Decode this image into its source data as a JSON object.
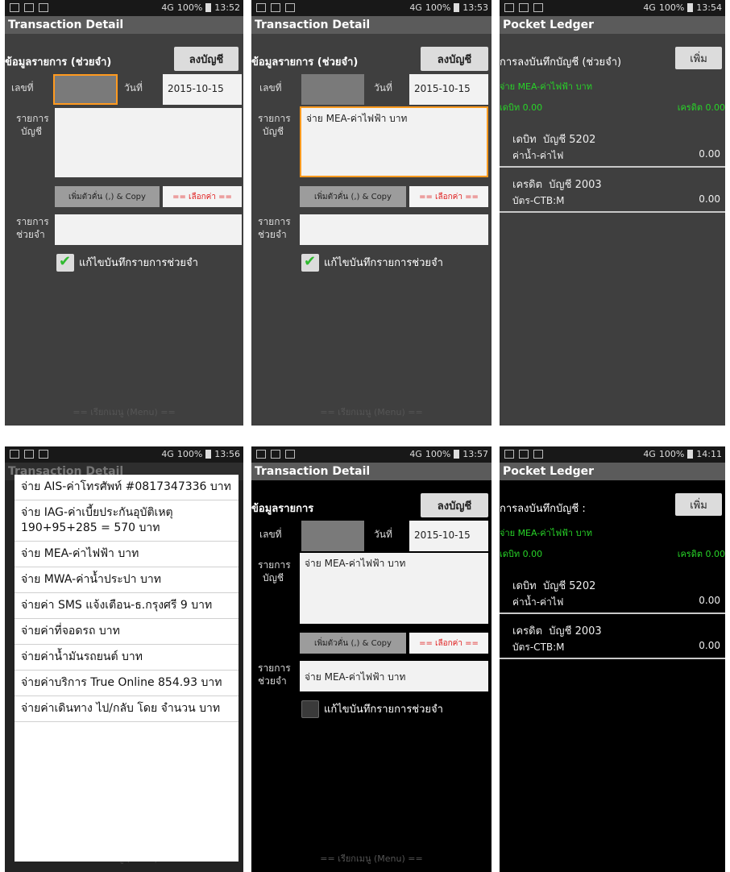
{
  "statusbar": {
    "network": "4G",
    "battery": "100%",
    "times": [
      "13:52",
      "13:53",
      "13:54",
      "13:56",
      "13:57",
      "14:11"
    ]
  },
  "titles": {
    "transaction_detail": "Transaction Detail",
    "pocket_ledger": "Pocket Ledger"
  },
  "form": {
    "heading_helper": "ข้อมูลรายการ (ช่วยจำ)",
    "heading_plain": "ข้อมูลรายการ",
    "post_button": "ลงบัญชี",
    "number_label": "เลขที่",
    "date_label": "วันที่",
    "date_value": "2015-10-15",
    "account_line1": "รายการ",
    "account_line2": "บัญชี",
    "account_value": "จ่าย MEA-ค่าไฟฟ้า  บาท",
    "add_sep_copy": "เพิ่มตัวคั่น (,) & Copy",
    "select_value": "== เลือกค่า ==",
    "helper_line1": "รายการ",
    "helper_line2": "ช่วยจำ",
    "helper_value": "จ่าย MEA-ค่าไฟฟ้า  บาท",
    "edit_helper_label": "แก้ไขบันทึกรายการช่วยจำ",
    "menu_hint": "== เรียกเมนู (Menu) =="
  },
  "ledger": {
    "heading_helper": "การลงบันทึกบัญชี (ช่วยจำ)",
    "heading_plain": "การลงบันทึกบัญชี :",
    "add_button": "เพิ่ม",
    "description": "จ่าย MEA-ค่าไฟฟ้า  บาท",
    "debit_total": "เดบิท 0.00",
    "credit_total": "เครดิต 0.00",
    "rows": [
      {
        "side": "เดบิท",
        "acct_label": "บัญชี",
        "acct_no": "5202",
        "acct_name": "ค่าน้ำ-ค่าไฟ",
        "amount": "0.00"
      },
      {
        "side": "เครดิต",
        "acct_label": "บัญชี",
        "acct_no": "2003",
        "acct_name": "บัตร-CTB:M",
        "amount": "0.00"
      }
    ]
  },
  "popup_items": [
    "จ่าย AIS-ค่าโทรศัพท์ #0817347336  บาท",
    "จ่าย IAG-ค่าเบี้ยประกันอุบัติเหตุ 190+95+285 = 570 บาท",
    "จ่าย MEA-ค่าไฟฟ้า  บาท",
    "จ่าย MWA-ค่าน้ำประปา บาท",
    "จ่ายค่า SMS แจ้งเตือน-ธ.กรุงศรี 9 บาท",
    "จ่ายค่าที่จอดรถ บาท",
    "จ่ายค่าน้ำมันรถยนต์  บาท",
    "จ่ายค่าบริการ True Online 854.93 บาท",
    "จ่ายค่าเดินทาง ไป/กลับ  โดย จำนวน  บาท"
  ],
  "colors": {
    "accent_orange": "#ff9a1f",
    "green_text": "#28d428",
    "red_select": "#e02020"
  }
}
